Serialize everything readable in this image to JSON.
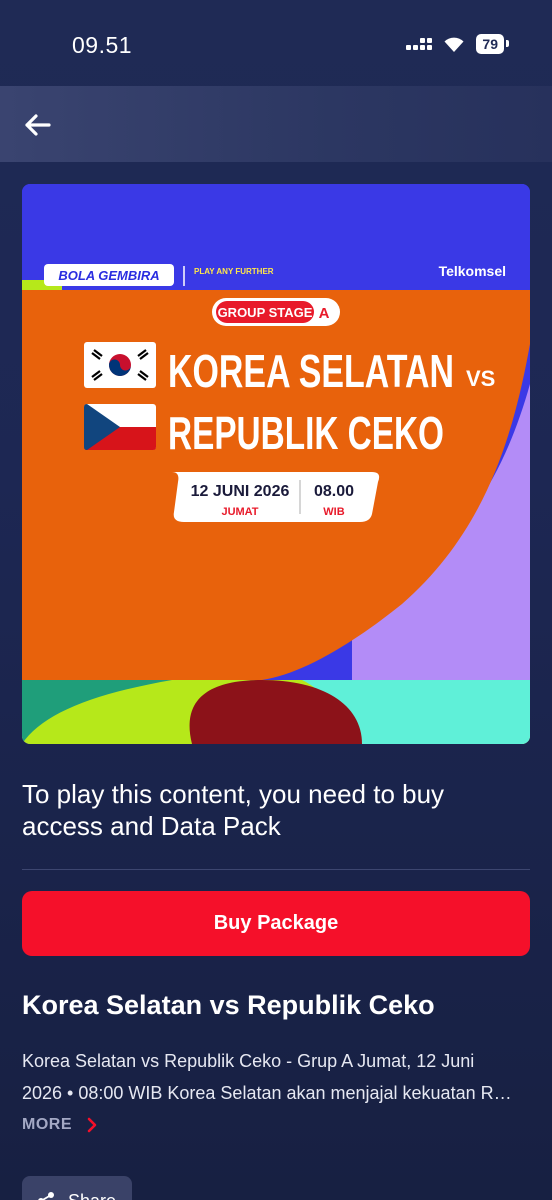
{
  "status_bar": {
    "time": "09.51",
    "battery": "79"
  },
  "banner": {
    "brand_left": "BOLA GEMBIRA",
    "brand_tag": "PLAY ANY FURTHER",
    "brand_right": "Telkomsel",
    "stage_label": "GROUP STAGE",
    "group_letter": "A",
    "team_home": "KOREA SELATAN",
    "vs": "VS",
    "team_away": "REPUBLIK CEKO",
    "date": "12 JUNI 2026",
    "day": "JUMAT",
    "time": "08.00",
    "timezone": "WIB"
  },
  "notice": "To play this content, you need to buy access and Data Pack",
  "buy_button_label": "Buy Package",
  "content": {
    "title": "Korea Selatan vs Republik Ceko",
    "description_line1": "Korea Selatan vs Republik Ceko - Grup A Jumat, 12 Juni",
    "description_line2": "2026 • 08:00 WIB Korea Selatan akan menjajal kekuatan R…",
    "more_label": "MORE"
  },
  "share_label": "Share",
  "colors": {
    "accent_red": "#f5102a",
    "banner_orange": "#e8620c",
    "banner_blue": "#3a39e6",
    "banner_purple": "#b38cf7"
  }
}
